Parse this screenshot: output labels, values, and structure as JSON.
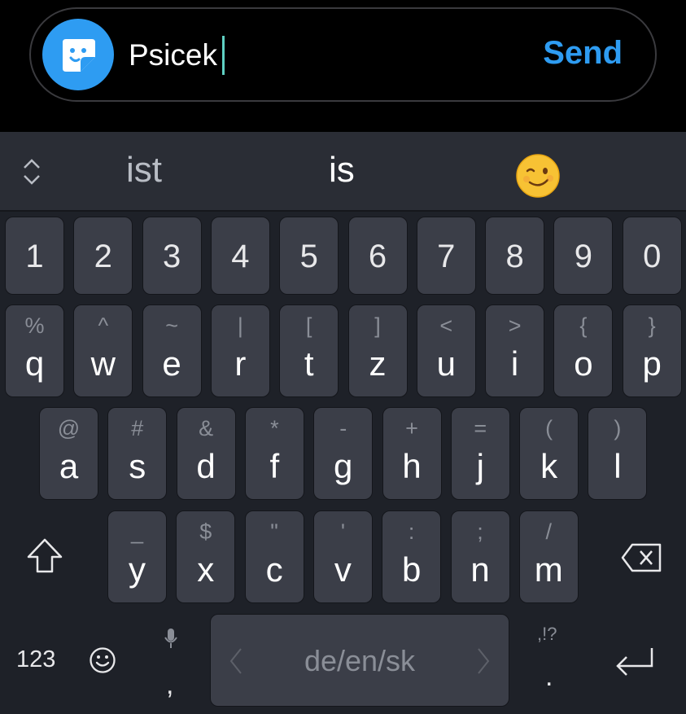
{
  "compose": {
    "input_value": "Psicek",
    "send_label": "Send",
    "accent_color": "#2e9cf2",
    "sticker_icon": "sticker-face-icon"
  },
  "suggestions": {
    "left": "ist",
    "center": "is",
    "emoji": "winking-face-emoji"
  },
  "keyboard": {
    "number_row": [
      "1",
      "2",
      "3",
      "4",
      "5",
      "6",
      "7",
      "8",
      "9",
      "0"
    ],
    "row1": {
      "letters": [
        "q",
        "w",
        "e",
        "r",
        "t",
        "z",
        "u",
        "i",
        "o",
        "p"
      ],
      "symbols": [
        "%",
        "^",
        "~",
        "|",
        "[",
        "]",
        "<",
        ">",
        "{",
        "}"
      ]
    },
    "row2": {
      "letters": [
        "a",
        "s",
        "d",
        "f",
        "g",
        "h",
        "j",
        "k",
        "l"
      ],
      "symbols": [
        "@",
        "#",
        "&",
        "*",
        "-",
        "+",
        "=",
        "(",
        ")"
      ]
    },
    "row3": {
      "letters": [
        "y",
        "x",
        "c",
        "v",
        "b",
        "n",
        "m"
      ],
      "symbols": [
        "_",
        "$",
        "\"",
        "'",
        ":",
        ";",
        "/"
      ]
    },
    "bottom": {
      "num_toggle": "123",
      "comma": ",",
      "space_label": "de/en/sk",
      "period": ".",
      "punct_hint": ",!?"
    }
  }
}
